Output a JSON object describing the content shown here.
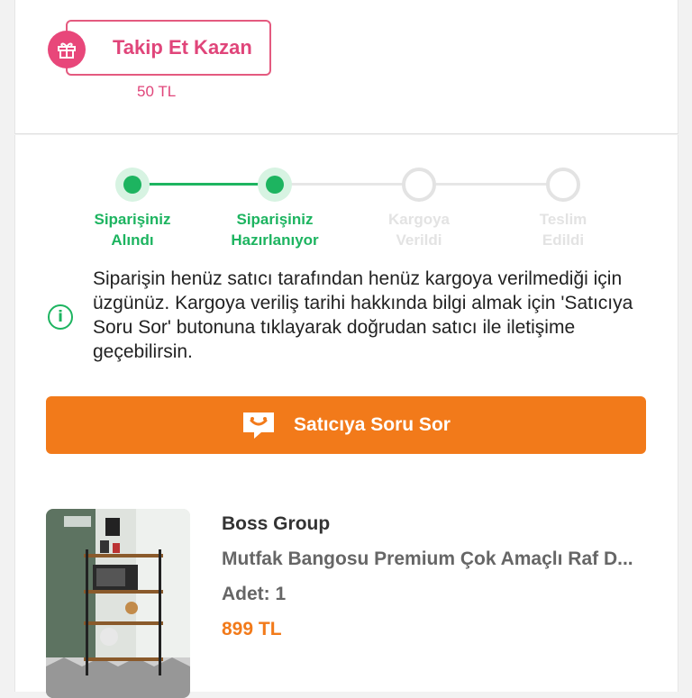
{
  "follow": {
    "button_label": "Takip Et Kazan",
    "reward": "50 TL",
    "icon": "gift-icon"
  },
  "stepper": {
    "steps": [
      {
        "label_line1": "Siparişiniz",
        "label_line2": "Alındı",
        "status": "done"
      },
      {
        "label_line1": "Siparişiniz",
        "label_line2": "Hazırlanıyor",
        "status": "done"
      },
      {
        "label_line1": "Kargoya",
        "label_line2": "Verildi",
        "status": "pending"
      },
      {
        "label_line1": "Teslim",
        "label_line2": "Edildi",
        "status": "pending"
      }
    ]
  },
  "info": {
    "icon": "info-icon",
    "text": "Siparişin henüz satıcı tarafından henüz kargoya verilmediği için üzgünüz. Kargoya veriliş tarihi hakkında bilgi almak için 'Satıcıya Soru Sor' butonuna tıklayarak doğrudan satıcı ile iletişime geçebilirsin."
  },
  "ask_seller": {
    "label": "Satıcıya Soru Sor",
    "icon": "chat-smile-icon"
  },
  "product": {
    "brand": "Boss Group",
    "name": "Mutfak Bangosu Premium Çok Amaçlı Raf D...",
    "quantity": "Adet: 1",
    "price": "899 TL"
  },
  "colors": {
    "accent_green": "#1db460",
    "accent_orange": "#f27a1a",
    "accent_pink": "#e0457a"
  }
}
